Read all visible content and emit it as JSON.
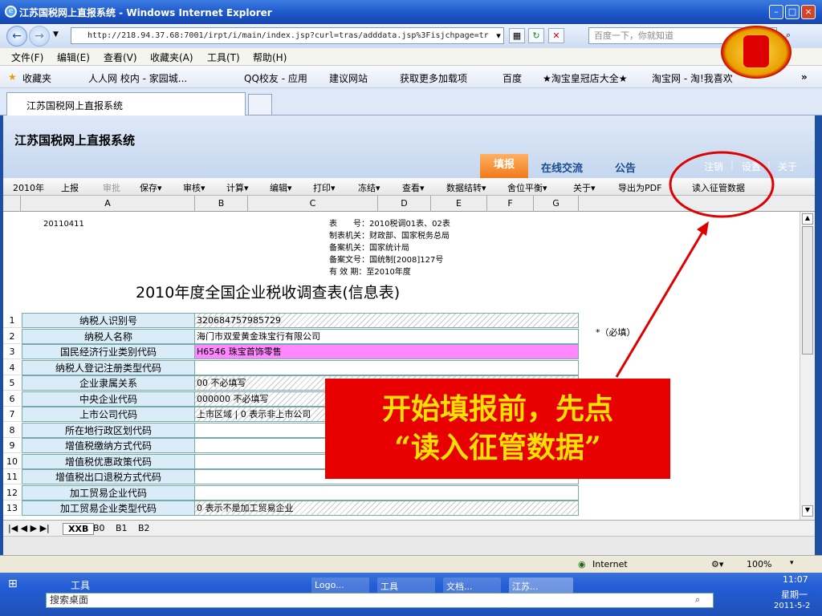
{
  "window": {
    "title": "江苏国税网上直报系统 - Windows Internet Explorer"
  },
  "nav": {
    "address": "http://218.94.37.68:7001/irpt/i/main/index.jsp?curl=tras/adddata.jsp%3Fisjchpage=tr",
    "search_placeholder": "百度一下，你就知道"
  },
  "menu": [
    "文件(F)",
    "编辑(E)",
    "查看(V)",
    "收藏夹(A)",
    "工具(T)",
    "帮助(H)"
  ],
  "favorites": {
    "label": "收藏夹",
    "items": [
      "人人网 校内 - 家园城...",
      "QQ校友 - 应用",
      "建议网站",
      "获取更多加载项",
      "百度",
      "★淘宝皇冠店大全★",
      "淘宝网 - 淘!我喜欢"
    ]
  },
  "tab": {
    "title": "江苏国税网上直报系统"
  },
  "app": {
    "title": "江苏国税网上直报系统",
    "tabs": [
      "填报",
      "在线交流",
      "公告"
    ],
    "links": [
      "注销",
      "设置",
      "关于"
    ],
    "toolbar": [
      "2010年",
      "上报",
      "审批",
      "保存▾",
      "审核▾",
      "计算▾",
      "编辑▾",
      "打印▾",
      "冻结▾",
      "查看▾",
      "数据结转▾",
      "舍位平衡▾",
      "关于▾",
      "导出为PDF"
    ],
    "read_button": "读入征管数据"
  },
  "sheet": {
    "columns": [
      "A",
      "B",
      "C",
      "D",
      "E",
      "F",
      "G"
    ],
    "date": "20110411",
    "meta": [
      "表　　号：2010税调01表、02表",
      "制表机关：财政部、国家税务总局",
      "备案机关：国家统计局",
      "备案文号：国统制[2008]127号",
      "有 效 期：至2010年度"
    ],
    "form_title": "2010年度全国企业税收调查表(信息表)",
    "required_note": "*（必填）",
    "rows": [
      {
        "n": "1",
        "label": "纳税人识别号",
        "value": "320684757985729"
      },
      {
        "n": "2",
        "label": "纳税人名称",
        "value": "海门市双爱黄金珠宝行有限公司"
      },
      {
        "n": "3",
        "label": "国民经济行业类别代码",
        "value": "H6546 珠宝首饰零售"
      },
      {
        "n": "4",
        "label": "纳税人登记注册类型代码",
        "value": ""
      },
      {
        "n": "5",
        "label": "企业隶属关系",
        "value": "00 不必填写"
      },
      {
        "n": "6",
        "label": "中央企业代码",
        "value": "000000 不必填写"
      },
      {
        "n": "7",
        "label": "上市公司代码",
        "value": "上市区域 | 0 表示非上市公司"
      },
      {
        "n": "8",
        "label": "所在地行政区划代码",
        "value": ""
      },
      {
        "n": "9",
        "label": "增值税缴纳方式代码",
        "value": ""
      },
      {
        "n": "10",
        "label": "增值税优惠政策代码",
        "value": ""
      },
      {
        "n": "11",
        "label": "增值税出口退税方式代码",
        "value": ""
      },
      {
        "n": "12",
        "label": "加工贸易企业代码",
        "value": ""
      },
      {
        "n": "13",
        "label": "加工贸易企业类型代码",
        "value": "0 表示不是加工贸易企业"
      }
    ],
    "sheet_tabs": [
      "XXB",
      "B0",
      "B1",
      "B2"
    ]
  },
  "callout": {
    "line1": "开始填报前，先点",
    "line2": "“读入征管数据”"
  },
  "status": {
    "zone": "Internet",
    "zoom": "100%"
  },
  "taskbar": {
    "tools": "工具",
    "buttons": [
      "Logo...",
      "工具",
      "文档...",
      "江苏..."
    ],
    "search_placeholder": "搜索桌面",
    "time": "11:07",
    "weekday": "星期一",
    "date": "2011-5-2"
  },
  "colors": {
    "callout_bg": "#e80000",
    "callout_text": "#ffe000",
    "annotation": "#e00000",
    "active_tab": "#f07a1a"
  }
}
